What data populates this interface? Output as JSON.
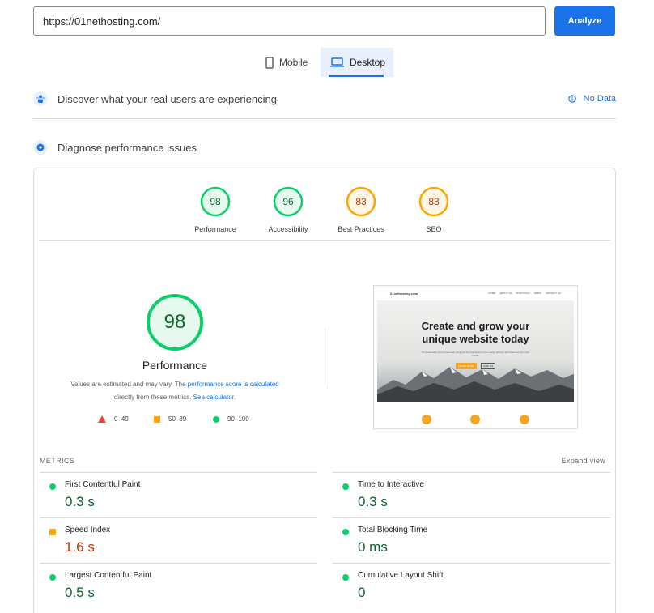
{
  "search": {
    "url_value": "https://01nethosting.com/",
    "analyze_label": "Analyze"
  },
  "tabs": [
    {
      "label": "Mobile",
      "icon": "phone-icon",
      "active": false
    },
    {
      "label": "Desktop",
      "icon": "laptop-icon",
      "active": true
    }
  ],
  "field_data": {
    "title": "Discover what your real users are experiencing",
    "status": "No Data"
  },
  "lab": {
    "title": "Diagnose performance issues"
  },
  "scores": [
    {
      "label": "Performance",
      "value": 98,
      "rating": "good"
    },
    {
      "label": "Accessibility",
      "value": 96,
      "rating": "good"
    },
    {
      "label": "Best Practices",
      "value": 83,
      "rating": "average"
    },
    {
      "label": "SEO",
      "value": 83,
      "rating": "average"
    }
  ],
  "main_score": {
    "value": 98,
    "label": "Performance",
    "note_text_1": "Values are estimated and may vary. The ",
    "note_link_1": "performance score is calculated",
    "note_text_2": "directly from these metrics. ",
    "note_link_2": "See calculator."
  },
  "legend": [
    {
      "range": "0–49",
      "marker": "triangle",
      "color": "#eb4335"
    },
    {
      "range": "50–89",
      "marker": "square",
      "color": "#ffa400"
    },
    {
      "range": "90–100",
      "marker": "circle",
      "color": "#0cce6b"
    }
  ],
  "screenshot": {
    "logo": "01nethosting.com",
    "nav": [
      "HOME",
      "ABOUT US",
      "PORTFOLIO",
      "NEWS",
      "CONTACT US"
    ],
    "headline_1": "Create and grow your",
    "headline_2": "unique website today",
    "body": "Professionally and humorously designed for businesses to be ready, efficient and stand out from the crowd.",
    "btn_primary": "LEARN MORE",
    "btn_secondary": "HIRE US"
  },
  "metrics_section": {
    "heading": "METRICS",
    "expand_label": "Expand view"
  },
  "metrics": [
    {
      "name": "First Contentful Paint",
      "value": "0.3 s",
      "rating": "good"
    },
    {
      "name": "Time to Interactive",
      "value": "0.3 s",
      "rating": "good"
    },
    {
      "name": "Speed Index",
      "value": "1.6 s",
      "rating": "average"
    },
    {
      "name": "Total Blocking Time",
      "value": "0 ms",
      "rating": "good"
    },
    {
      "name": "Largest Contentful Paint",
      "value": "0.5 s",
      "rating": "good"
    },
    {
      "name": "Cumulative Layout Shift",
      "value": "0",
      "rating": "good"
    }
  ],
  "colors": {
    "accent": "#1a73e8",
    "good": "#0cce6b",
    "average": "#ffa400",
    "poor": "#eb4335"
  }
}
